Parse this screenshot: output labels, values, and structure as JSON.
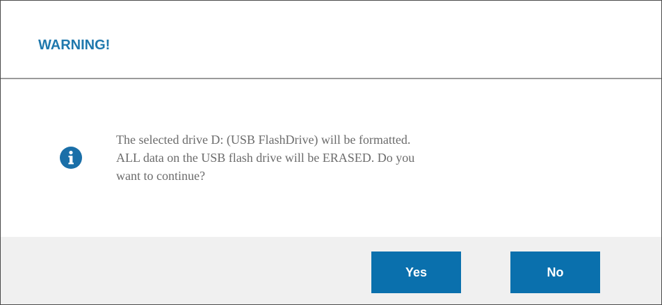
{
  "dialog": {
    "title": "WARNING!",
    "icon": "info-icon",
    "message": "The selected drive  D: (USB FlashDrive)  will be formatted.\nALL data on the USB flash drive will be ERASED.  Do you\nwant to continue?",
    "buttons": {
      "yes_label": "Yes",
      "no_label": "No"
    }
  },
  "colors": {
    "title": "#1f78ad",
    "button_bg": "#0a70ad",
    "button_text": "#ffffff",
    "footer_bg": "#f0f0f0",
    "message_text": "#6b6b6b",
    "icon_bg": "#1a6fa8"
  }
}
